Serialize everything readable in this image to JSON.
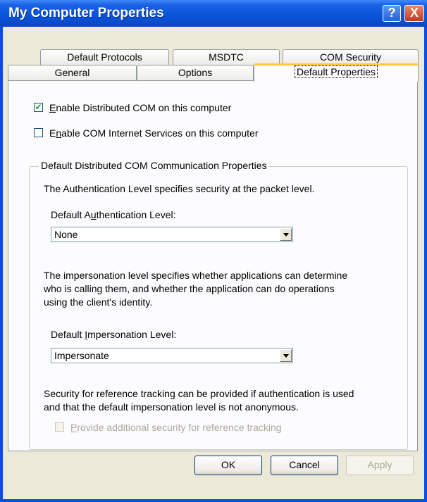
{
  "window": {
    "title": "My Computer Properties",
    "help_label": "?",
    "close_label": "X"
  },
  "tabs": {
    "row1": [
      "Default Protocols",
      "MSDTC",
      "COM Security"
    ],
    "row2": [
      "General",
      "Options",
      "Default Properties"
    ],
    "active": "Default Properties"
  },
  "options": {
    "enable_dcom": {
      "label_pre": "",
      "label_key": "E",
      "label_post": "nable Distributed COM on this computer",
      "checked": true
    },
    "enable_cis": {
      "label_pre": "E",
      "label_key": "n",
      "label_post": "able COM Internet Services on this computer",
      "checked": false
    }
  },
  "group": {
    "legend": "Default Distributed COM Communication Properties",
    "auth_desc": "The Authentication Level specifies security at the packet level.",
    "auth_label_pre": "Default A",
    "auth_label_key": "u",
    "auth_label_post": "thentication Level:",
    "auth_value": "None",
    "imp_desc_1": "The impersonation level specifies whether applications can determine",
    "imp_desc_2": "who is calling them, and whether the application can do operations",
    "imp_desc_3": "using the client's identity.",
    "imp_label_pre": "Default ",
    "imp_label_key": "I",
    "imp_label_post": "mpersonation Level:",
    "imp_value": "Impersonate",
    "ref_desc_1": "Security for reference tracking can be provided if authentication is used",
    "ref_desc_2": "and that the default impersonation level is not anonymous.",
    "ref_checkbox": {
      "label_pre": "",
      "label_key": "P",
      "label_post": "rovide additional security for reference tracking",
      "checked": false,
      "enabled": false
    }
  },
  "buttons": {
    "ok": "OK",
    "cancel": "Cancel",
    "apply": "Apply"
  },
  "colors": {
    "titlebar": "#0a55d8",
    "dialog_bg": "#ece9d8",
    "tab_highlight": "#ffc83c",
    "check_mark": "#21a121"
  }
}
